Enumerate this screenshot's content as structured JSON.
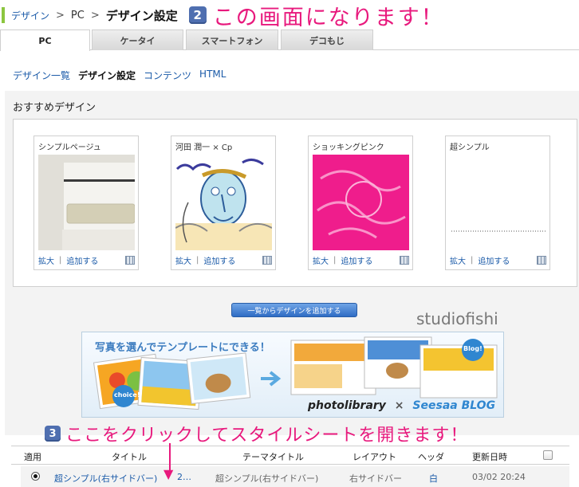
{
  "breadcrumb": {
    "root": "デザイン",
    "mid": "PC",
    "current": "デザイン設定",
    "sep": ">"
  },
  "annotations": {
    "step2_num": "2",
    "step2_text": "この画面になります！",
    "step3_num": "3",
    "step3_text": "ここをクリックしてスタイルシートを開きます！"
  },
  "tabs": [
    "PC",
    "ケータイ",
    "スマートフォン",
    "デコもじ"
  ],
  "subnav": [
    "デザイン一覧",
    "デザイン設定",
    "コンテンツ",
    "HTML"
  ],
  "recommended": {
    "title": "おすすめデザイン",
    "zoom_label": "拡大",
    "add_label": "追加する",
    "pipe": "|",
    "cards": [
      {
        "name": "シンプルページュ"
      },
      {
        "name": "河田 潤一 × Cp"
      },
      {
        "name": "ショッキングピンク"
      },
      {
        "name": "超シンプル"
      }
    ]
  },
  "add_button": "一覧からデザインを追加する",
  "credit": "studiofishi",
  "banner": {
    "headline": "写真を選んでテンプレートにできる！",
    "choice": "choice!",
    "blog": "Blog!",
    "logo_left": "photolibrary",
    "logo_x": "×",
    "logo_right": "Seesaa BLOG"
  },
  "table": {
    "headers": [
      "適用",
      "タイトル",
      "テーマタイトル",
      "レイアウト",
      "ヘッダ",
      "更新日時"
    ],
    "row": {
      "title": "超シンプル(右サイドバー)",
      "title_more": "2…",
      "theme": "超シンプル(右サイドバー)",
      "layout": "右サイドバー",
      "header": "白",
      "updated": "03/02 20:24"
    }
  },
  "colors": {
    "accent": "#e8197d",
    "link": "#1a5aa8",
    "badge": "#4f6fb0"
  }
}
